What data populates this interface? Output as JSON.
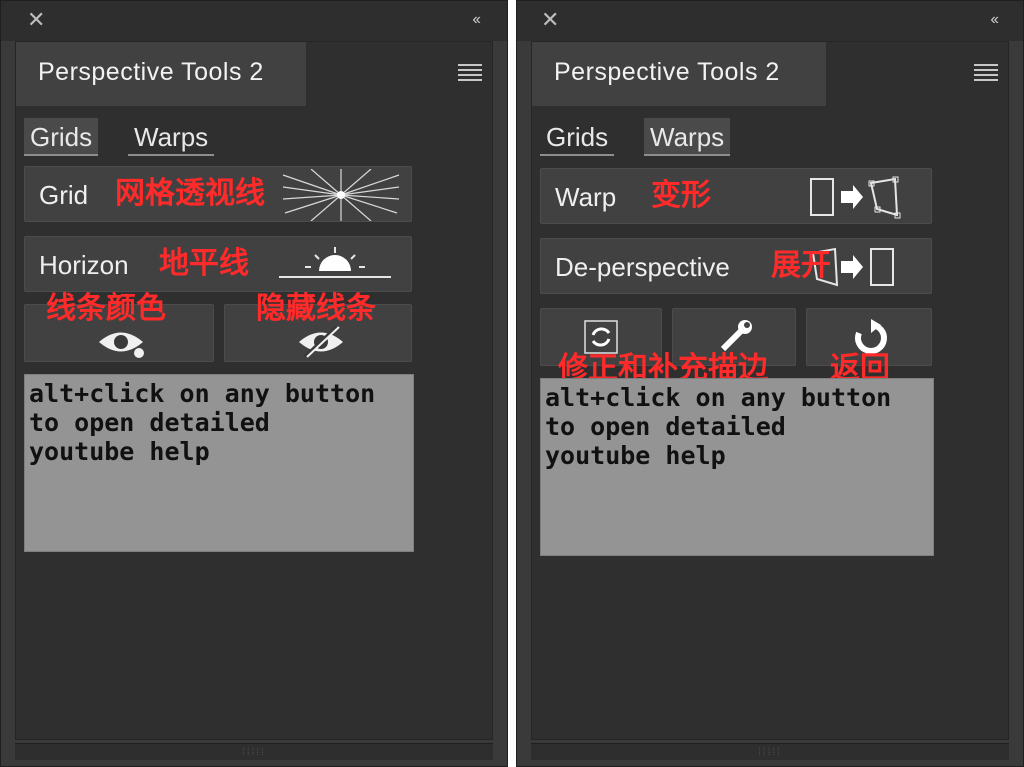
{
  "panels": [
    {
      "title": "Perspective Tools 2",
      "tabs": [
        {
          "label": "Grids",
          "active": true
        },
        {
          "label": "Warps",
          "active": false
        }
      ],
      "buttons": [
        {
          "label": "Grid",
          "annotation": "网格透视线"
        },
        {
          "label": "Horizon",
          "annotation": "地平线"
        }
      ],
      "annotations_row": [
        "线条颜色",
        "隐藏线条"
      ],
      "help_text": "alt+click on any button\nto open detailed\nyoutube help"
    },
    {
      "title": "Perspective Tools 2",
      "tabs": [
        {
          "label": "Grids",
          "active": false
        },
        {
          "label": "Warps",
          "active": true
        }
      ],
      "buttons": [
        {
          "label": "Warp",
          "annotation": "变形"
        },
        {
          "label": "De-perspective",
          "annotation": "展开"
        }
      ],
      "annotations_row": [
        "修正和补充描边",
        "返回"
      ],
      "help_text": "alt+click on any button\nto open detailed\nyoutube help"
    }
  ],
  "icons": {
    "close": "close-icon",
    "collapse": "collapse-icon",
    "menu": "panel-menu-icon"
  },
  "colors": {
    "panel_bg": "#3a3a3a",
    "annotation_red": "#ff2a2a",
    "help_bg": "#949494"
  }
}
